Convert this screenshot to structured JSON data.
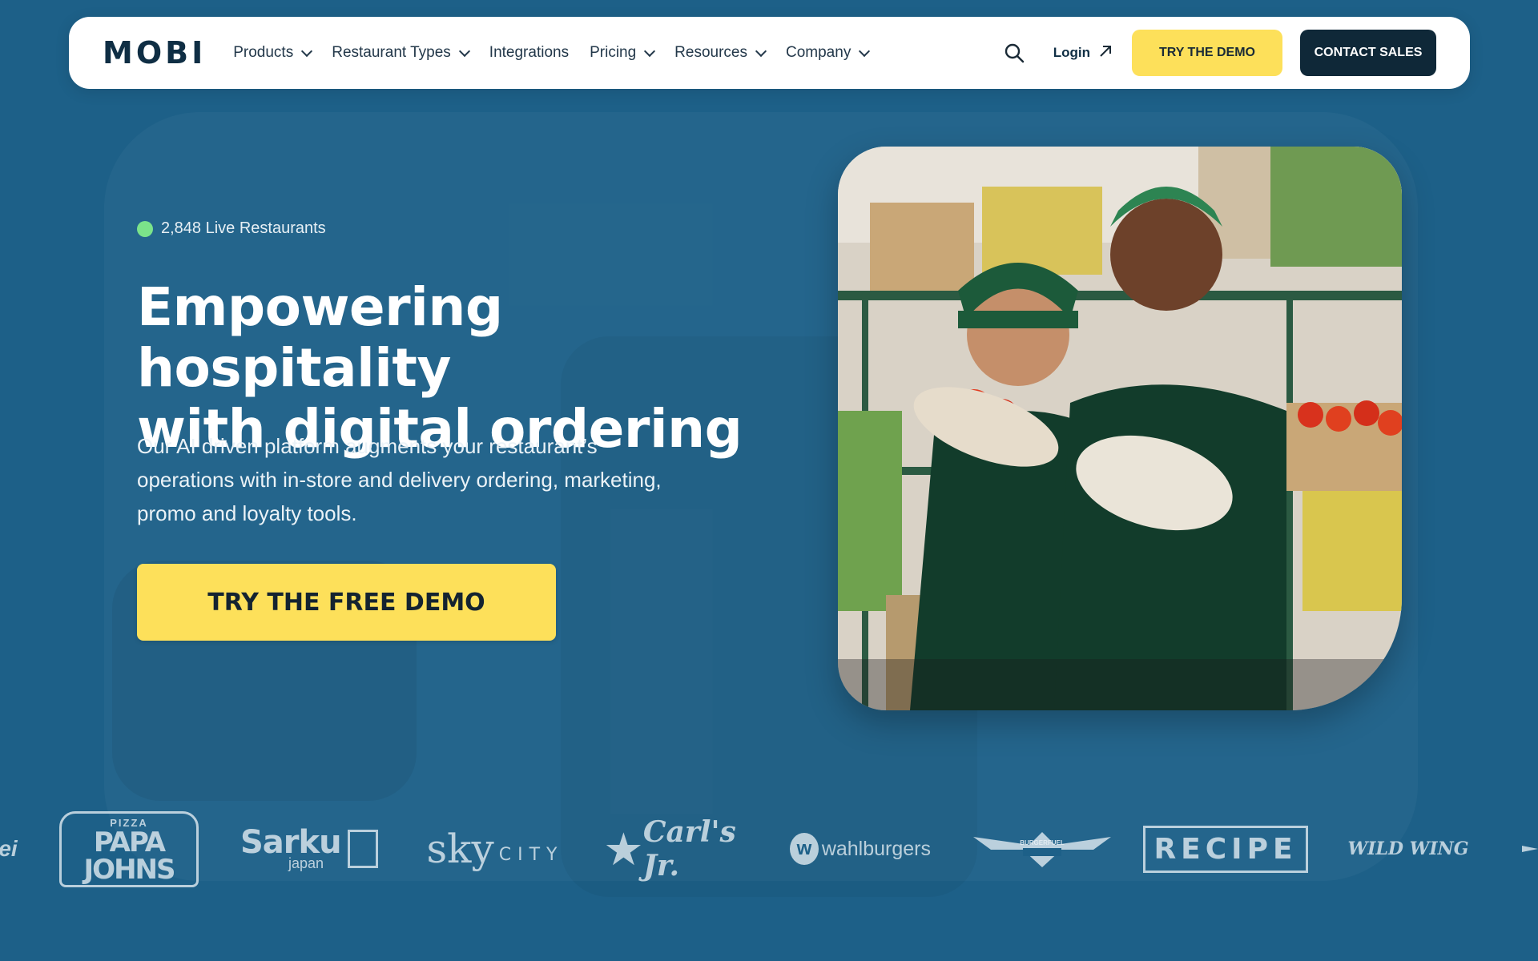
{
  "nav": {
    "logo": "MOBI",
    "items": [
      {
        "label": "Products",
        "dropdown": true
      },
      {
        "label": "Restaurant Types",
        "dropdown": true
      },
      {
        "label": "Integrations",
        "dropdown": false
      },
      {
        "label": "Pricing",
        "dropdown": true
      },
      {
        "label": "Resources",
        "dropdown": true
      },
      {
        "label": "Company",
        "dropdown": true
      }
    ],
    "login_label": "Login",
    "demo_button": "TRY THE DEMO",
    "sales_button": "CONTACT SALES"
  },
  "hero": {
    "live_count": "2,848 Live Restaurants",
    "headline_line1": "Empowering hospitality",
    "headline_line2": "with digital ordering",
    "subtext": "Our AI driven platform augments your restaurant’s operations with in-store and delivery ordering, marketing, promo and loyalty tools.",
    "cta": "TRY THE FREE DEMO"
  },
  "brands": {
    "partial_left": "ei",
    "papa_small": "PIZZA",
    "papa_big": "PAPA JOHNS",
    "sarku": "Sarku",
    "sarku_sub": "japan",
    "sky": "sky",
    "sky_city": "CITY",
    "carls": "Carl's Jr.",
    "wahl_mark": "w",
    "wahl": "wahlburgers",
    "burgerfuel": "BURGERFUEL",
    "recipe": "RECIPE",
    "wild": "WILD WING"
  },
  "colors": {
    "background": "#1d6088",
    "accent_yellow": "#fde05a",
    "dark_navy": "#0f2838",
    "live_green": "#7be38a"
  }
}
